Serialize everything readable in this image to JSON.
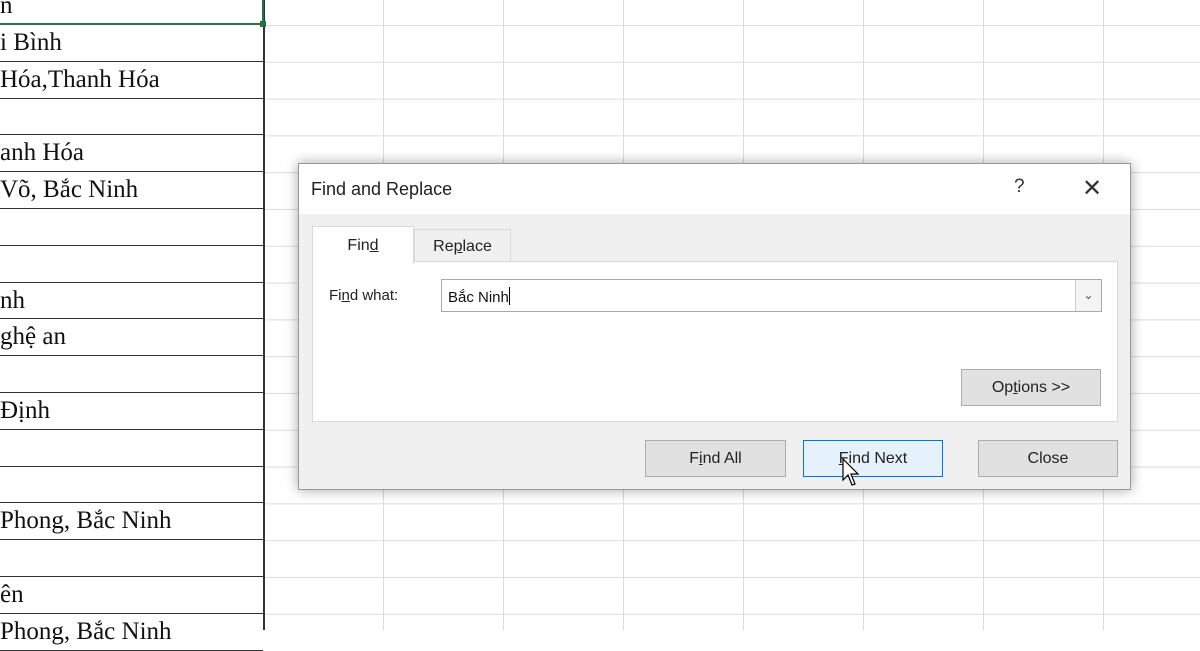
{
  "spreadsheet": {
    "cells": [
      "n",
      "i Bình",
      "Hóa,Thanh Hóa",
      "",
      "anh Hóa",
      "Võ, Bắc Ninh",
      "",
      "",
      "nh",
      "ghệ an",
      "",
      " Định",
      "",
      " ",
      " Phong, Bắc Ninh",
      "",
      "ên",
      "Phong, Bắc Ninh"
    ]
  },
  "dialog": {
    "title": "Find and Replace",
    "help": "?",
    "close": "✕",
    "tabs": [
      {
        "label_pre": "Fin",
        "label_key": "d",
        "label_post": ""
      },
      {
        "label_pre": "Re",
        "label_key": "p",
        "label_post": "lace"
      }
    ],
    "find_what_label_pre": "Fi",
    "find_what_label_key": "n",
    "find_what_label_post": "d what:",
    "find_what_value": "Bắc Ninh",
    "options": {
      "pre": "Op",
      "key": "t",
      "post": "ions >>"
    },
    "find_all": {
      "pre": "F",
      "key": "i",
      "post": "nd All"
    },
    "find_next": {
      "pre": "",
      "key": "F",
      "post": "ind Next"
    },
    "close_button": "Close"
  }
}
